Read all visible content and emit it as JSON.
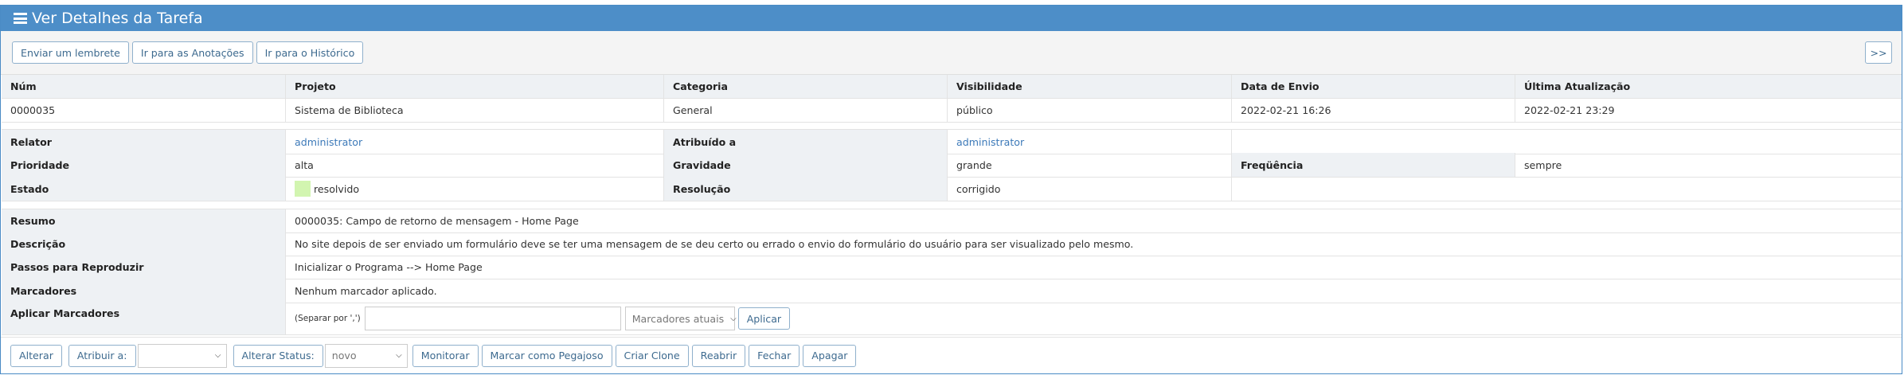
{
  "header": {
    "title": "Ver Detalhes da Tarefa",
    "icon": "bars-icon"
  },
  "toolbar": {
    "reminder_label": "Enviar um lembrete",
    "notes_label": "Ir para as Anotações",
    "history_label": "Ir para o Histórico",
    "next_label": ">>"
  },
  "summary_table": {
    "headers": [
      "Núm",
      "Projeto",
      "Categoria",
      "Visibilidade",
      "Data de Envio",
      "Última Atualização"
    ],
    "values": [
      "0000035",
      "Sistema de Biblioteca",
      "General",
      "público",
      "2022-02-21 16:26",
      "2022-02-21 23:29"
    ]
  },
  "details": {
    "reporter_label": "Relator",
    "reporter_value": "administrator",
    "assigned_label": "Atribuído a",
    "assigned_value": "administrator",
    "priority_label": "Prioridade",
    "priority_value": "alta",
    "severity_label": "Gravidade",
    "severity_value": "grande",
    "frequency_label": "Freqüência",
    "frequency_value": "sempre",
    "status_label": "Estado",
    "status_value": "resolvido",
    "status_color": "#d2f5b0",
    "resolution_label": "Resolução",
    "resolution_value": "corrigido"
  },
  "description": {
    "summary_label": "Resumo",
    "summary_value": "0000035: Campo de retorno de mensagem - Home Page",
    "description_label": "Descrição",
    "description_value": "No site depois de ser enviado um formulário deve se ter uma mensagem de se deu certo ou errado o envio do formulário do usuário para ser visualizado pelo mesmo.",
    "steps_label": "Passos para Reproduzir",
    "steps_value": "Inicializar o Programa --> Home Page",
    "tags_label": "Marcadores",
    "tags_value": "Nenhum marcador aplicado.",
    "apply_tags_label": "Aplicar Marcadores",
    "separator_hint": "(Separar por ',')",
    "tags_input_value": "",
    "current_tags_select": "Marcadores atuais",
    "apply_button": "Aplicar"
  },
  "actions": {
    "edit_label": "Alterar",
    "assign_label": "Atribuir a:",
    "assign_select_value": "",
    "change_status_label": "Alterar Status:",
    "status_select_value": "novo",
    "monitor_label": "Monitorar",
    "sticky_label": "Marcar como Pegajoso",
    "clone_label": "Criar Clone",
    "reopen_label": "Reabrir",
    "close_label": "Fechar",
    "delete_label": "Apagar"
  }
}
